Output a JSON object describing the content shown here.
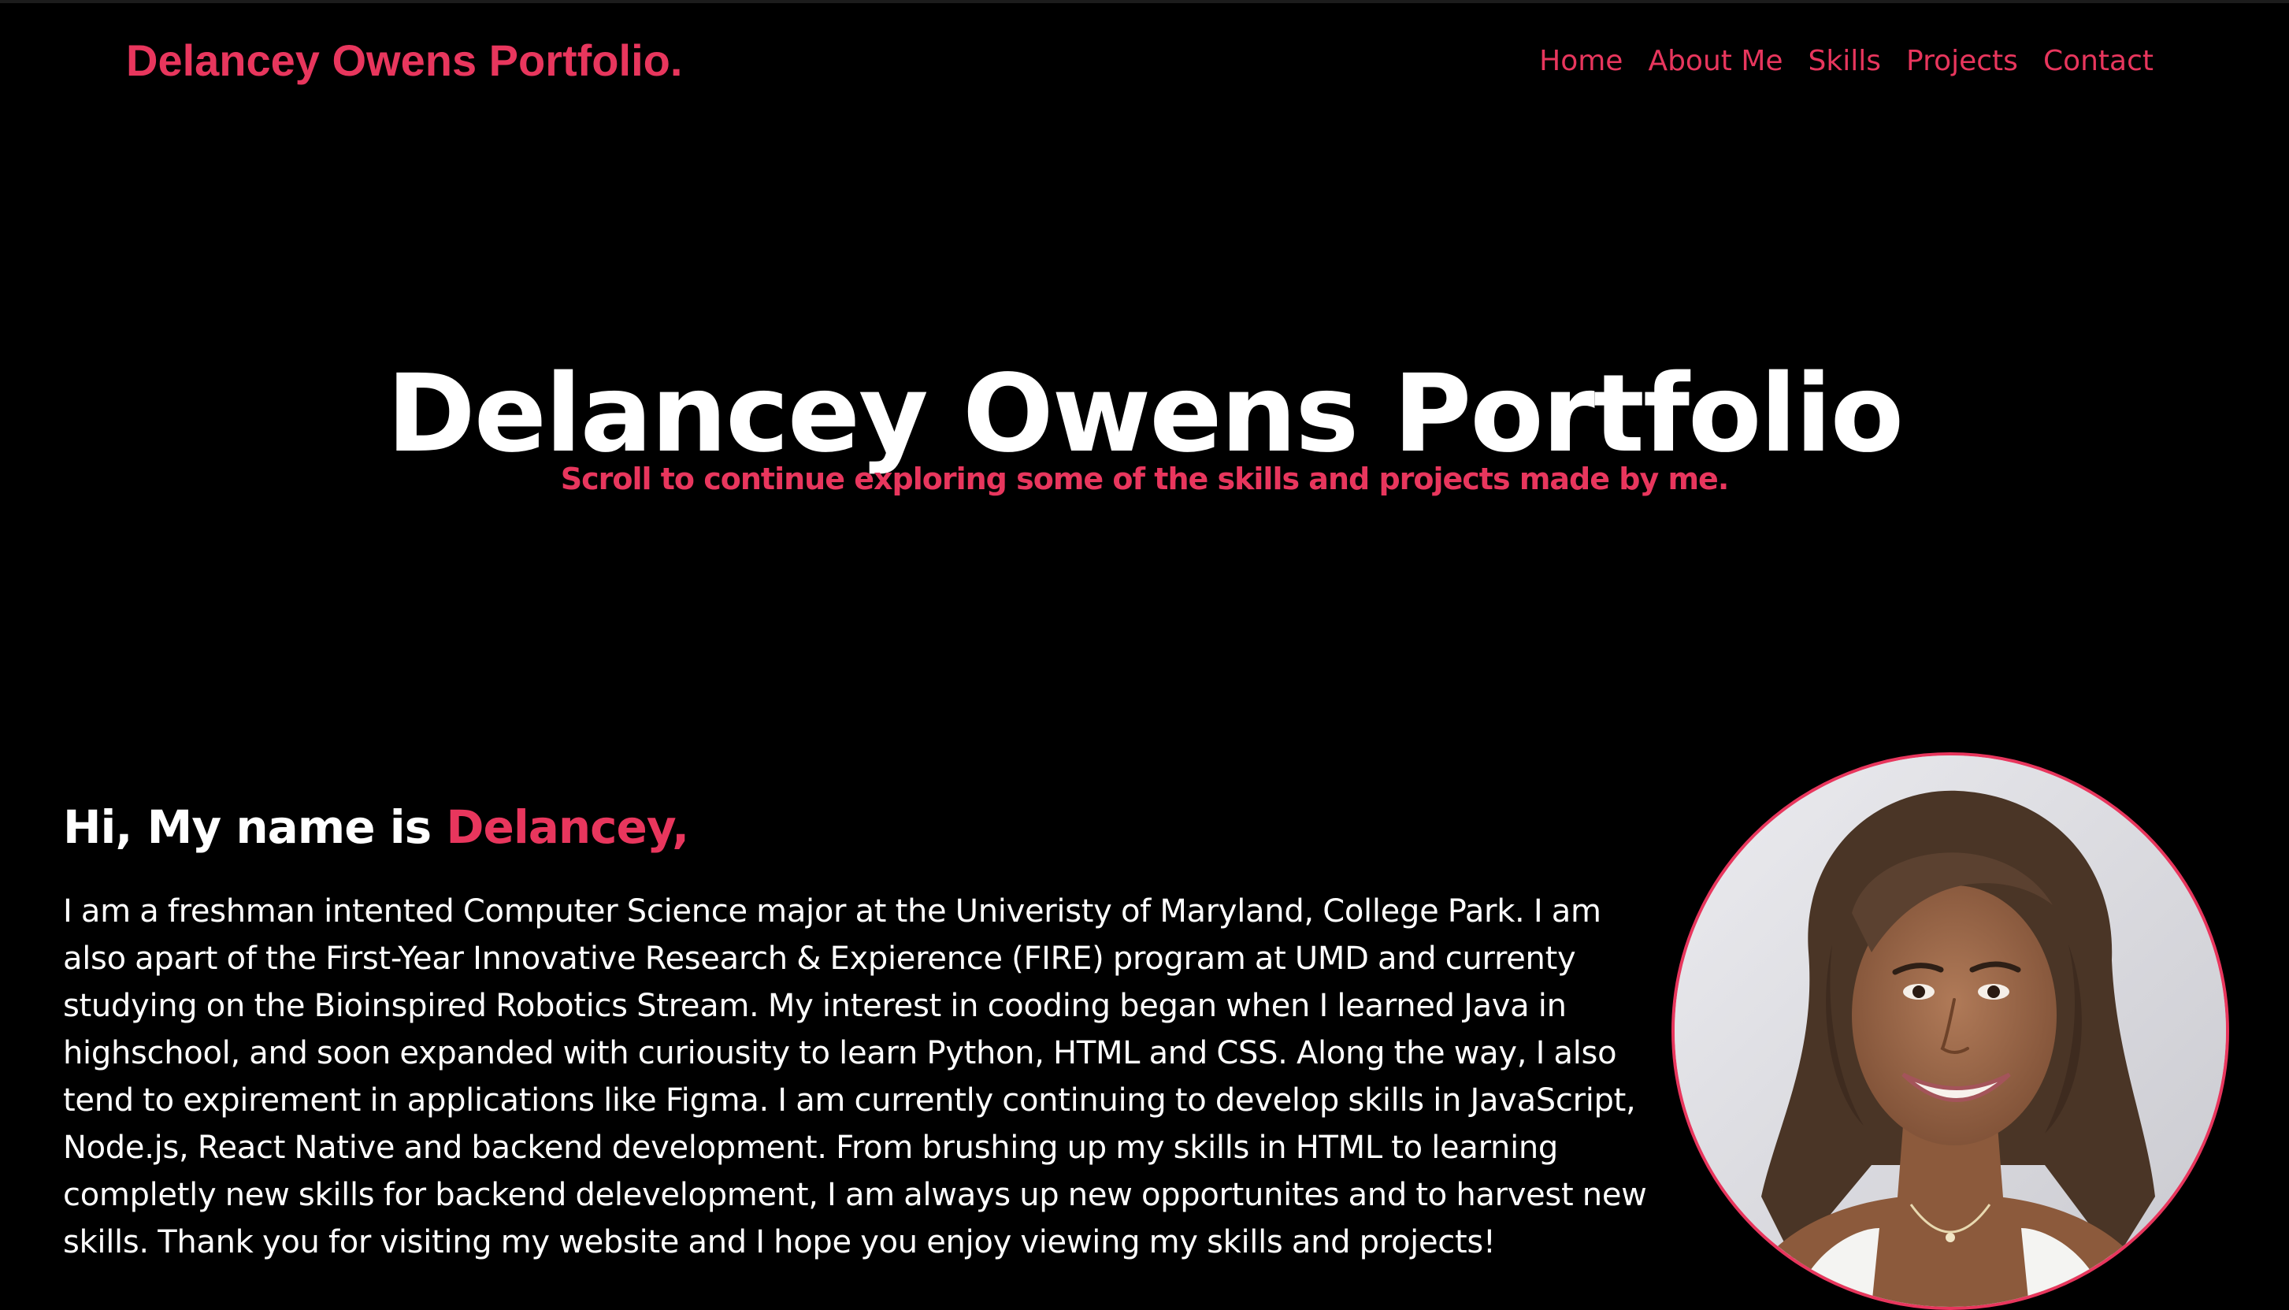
{
  "nav": {
    "brand": "Delancey Owens Portfolio.",
    "links": [
      "Home",
      "About Me",
      "Skills",
      "Projects",
      "Contact"
    ]
  },
  "hero": {
    "title": "Delancey Owens Portfolio",
    "subtitle": "Scroll to continue exploring some of the skills and projects made by me."
  },
  "about": {
    "greeting": "Hi, My name is ",
    "name": "Delancey,",
    "paragraph_lines": [
      "I am a freshman intented Computer Science major at the Univeristy of Maryland, College Park. I am",
      "also apart of the First-Year Innovative Research & Expierence (FIRE) program at UMD and currenty",
      "studying on the Bioinspired Robotics Stream. My interest in cooding began when I learned Java in",
      "highschool, and soon expanded with curiousity to learn Python, HTML and CSS. Along the way, I also",
      "tend to expirement in applications like Figma. I am currently continuing to develop skills in JavaScript,",
      "Node.js, React Native and backend development. From brushing up my skills in HTML to learning",
      "completly new skills for backend delevelopment, I am always up new opportunites and to harvest new",
      "skills. Thank you for visiting my website and I hope you enjoy viewing my skills and projects!"
    ]
  },
  "colors": {
    "background": "#000000",
    "accent": "#e8365d",
    "text": "#ffffff"
  }
}
